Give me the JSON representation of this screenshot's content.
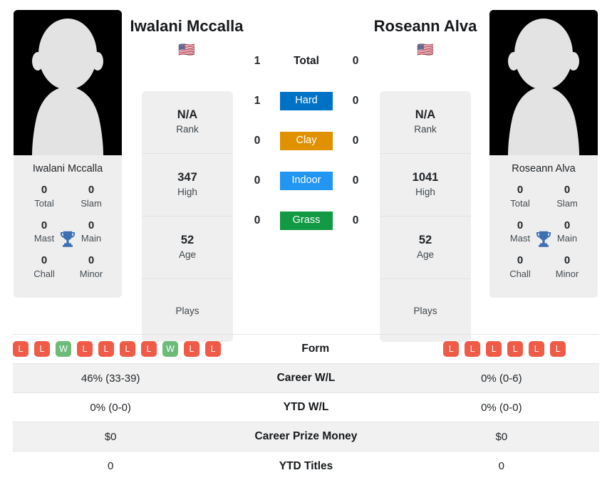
{
  "players": {
    "left": {
      "name": "Iwalani Mccalla",
      "flag": "🇺🇸",
      "card_name": "Iwalani Mccalla",
      "titles": [
        {
          "value": "0",
          "label": "Total"
        },
        {
          "value": "0",
          "label": "Slam"
        },
        {
          "value": "0",
          "label": "Mast"
        },
        {
          "value": "0",
          "label": "Main"
        },
        {
          "value": "0",
          "label": "Chall"
        },
        {
          "value": "0",
          "label": "Minor"
        }
      ],
      "stats": [
        {
          "value": "N/A",
          "label": "Rank"
        },
        {
          "value": "347",
          "label": "High"
        },
        {
          "value": "52",
          "label": "Age"
        },
        {
          "value": "",
          "label": "Plays"
        }
      ],
      "form": [
        "L",
        "L",
        "W",
        "L",
        "L",
        "L",
        "L",
        "W",
        "L",
        "L"
      ]
    },
    "right": {
      "name": "Roseann Alva",
      "flag": "🇺🇸",
      "card_name": "Roseann Alva",
      "titles": [
        {
          "value": "0",
          "label": "Total"
        },
        {
          "value": "0",
          "label": "Slam"
        },
        {
          "value": "0",
          "label": "Mast"
        },
        {
          "value": "0",
          "label": "Main"
        },
        {
          "value": "0",
          "label": "Chall"
        },
        {
          "value": "0",
          "label": "Minor"
        }
      ],
      "stats": [
        {
          "value": "N/A",
          "label": "Rank"
        },
        {
          "value": "1041",
          "label": "High"
        },
        {
          "value": "52",
          "label": "Age"
        },
        {
          "value": "",
          "label": "Plays"
        }
      ],
      "form": [
        "L",
        "L",
        "L",
        "L",
        "L",
        "L"
      ]
    }
  },
  "h2h": {
    "rows": [
      {
        "left": "1",
        "label": "Total",
        "right": "0",
        "type": "total",
        "color": ""
      },
      {
        "left": "1",
        "label": "Hard",
        "right": "0",
        "type": "surface",
        "color": "#0072c6"
      },
      {
        "left": "0",
        "label": "Clay",
        "right": "0",
        "type": "surface",
        "color": "#e09100"
      },
      {
        "left": "0",
        "label": "Indoor",
        "right": "0",
        "type": "surface",
        "color": "#2196f3"
      },
      {
        "left": "0",
        "label": "Grass",
        "right": "0",
        "type": "surface",
        "color": "#119943"
      }
    ]
  },
  "comparison": {
    "form_label": "Form",
    "rows": [
      {
        "left": "46% (33-39)",
        "label": "Career W/L",
        "right": "0% (0-6)"
      },
      {
        "left": "0% (0-0)",
        "label": "YTD W/L",
        "right": "0% (0-0)"
      },
      {
        "left": "$0",
        "label": "Career Prize Money",
        "right": "$0"
      },
      {
        "left": "0",
        "label": "YTD Titles",
        "right": "0"
      }
    ]
  },
  "colors": {
    "win": "#6cbb79",
    "loss": "#ef5b46",
    "trophy": "#3d6fb4"
  }
}
